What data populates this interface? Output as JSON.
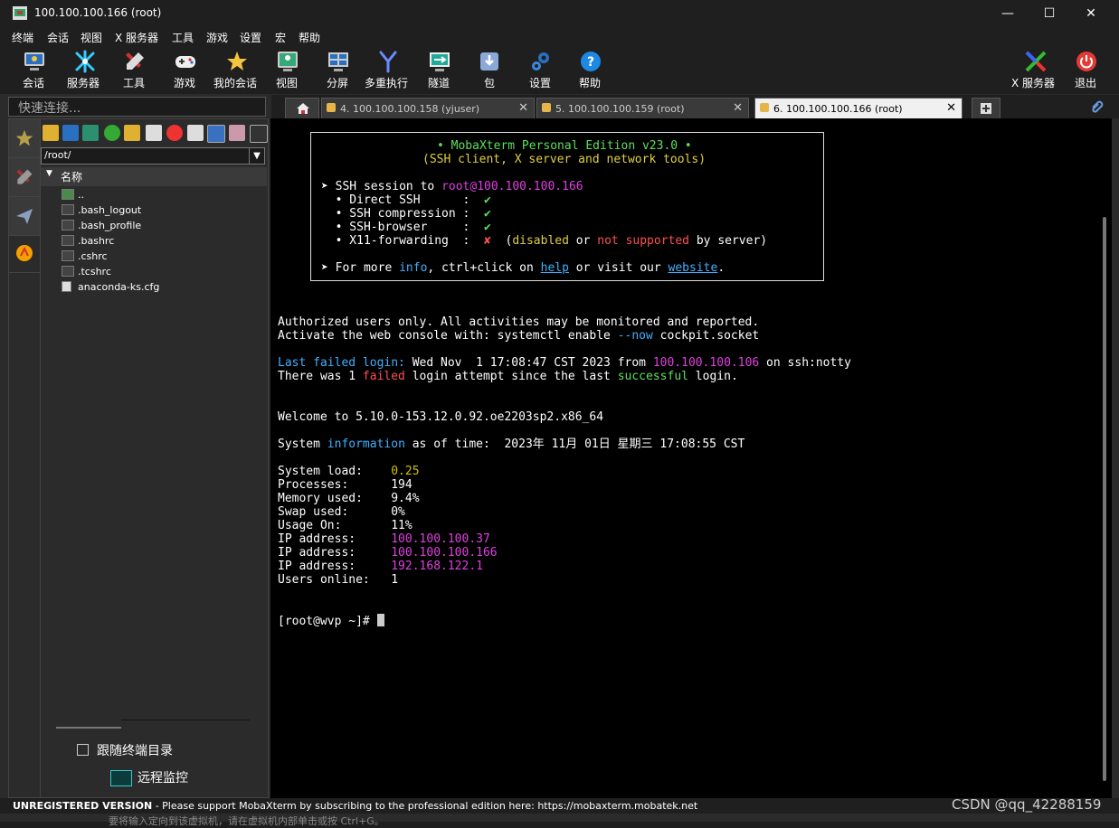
{
  "window": {
    "title": "100.100.100.166 (root)",
    "controls": [
      "—",
      "☐",
      "✕"
    ]
  },
  "menu": [
    "终端",
    "会话",
    "视图",
    "X 服务器",
    "工具",
    "游戏",
    "设置",
    "宏",
    "帮助"
  ],
  "toolbar": {
    "items": [
      {
        "label": "会话",
        "icon": "session-icon"
      },
      {
        "label": "服务器",
        "icon": "servers-icon"
      },
      {
        "label": "工具",
        "icon": "tools-icon"
      },
      {
        "label": "游戏",
        "icon": "games-icon"
      },
      {
        "label": "我的会话",
        "icon": "star-icon"
      },
      {
        "label": "视图",
        "icon": "view-icon"
      },
      {
        "label": "分屏",
        "icon": "split-icon"
      },
      {
        "label": "多重执行",
        "icon": "multiexec-icon"
      },
      {
        "label": "隧道",
        "icon": "tunnel-icon"
      },
      {
        "label": "包",
        "icon": "package-icon"
      },
      {
        "label": "设置",
        "icon": "settings-icon"
      },
      {
        "label": "帮助",
        "icon": "help-icon"
      },
      {
        "label": "X 服务器",
        "icon": "x-server-icon"
      },
      {
        "label": "退出",
        "icon": "power-icon"
      }
    ]
  },
  "quick_connect": {
    "placeholder": "快速连接..."
  },
  "tabs": [
    {
      "label": "4. 100.100.100.158 (yjuser)",
      "close": "✕"
    },
    {
      "label": "5. 100.100.100.159 (root)",
      "close": "✕"
    },
    {
      "label": "6. 100.100.100.166 (root)",
      "close": "✕"
    }
  ],
  "sftp": {
    "path": "/root/",
    "column_header": "名称",
    "files": [
      "..",
      ".bash_logout",
      ".bash_profile",
      ".bashrc",
      ".cshrc",
      ".tcshrc",
      "anaconda-ks.cfg"
    ],
    "follow_label": "跟随终端目录",
    "monitor_label": "远程监控"
  },
  "terminal": {
    "banner_title": "• MobaXterm Personal Edition v23.0 •",
    "banner_sub": "(SSH client, X server and network tools)",
    "ssh_session_prefix": "➤ SSH session to ",
    "ssh_target": "root@100.100.100.166",
    "opt1": "  • Direct SSH      :  ",
    "opt2": "  • SSH compression :  ",
    "opt3": "  • SSH-browser     :  ",
    "opt4": "  • X11-forwarding  :  ",
    "check": "✔",
    "cross": "✘",
    "x11_note_a": "  (",
    "x11_disabled": "disabled",
    "x11_or": " or ",
    "x11_notsupported": "not supported",
    "x11_by": " by server)",
    "more_a": "➤ For more ",
    "more_info": "info",
    "more_b": ", ctrl+click on ",
    "more_help": "help",
    "more_c": " or visit our ",
    "more_website": "website",
    "more_d": ".",
    "auth1": "Authorized users only. All activities may be monitored and reported.",
    "auth2a": "Activate the web console with: systemctl enable ",
    "auth2b": "--now",
    "auth2c": " cockpit.socket",
    "lastfail_a": "Last failed login:",
    "lastfail_b": " Wed Nov  1 17:08:47 CST 2023 from ",
    "lastfail_ip": "100.100.100.106",
    "lastfail_c": " on ssh:notty",
    "was_a": "There was 1 ",
    "was_failed": "failed",
    "was_b": " login attempt since the last ",
    "was_successful": "successful",
    "was_c": " login.",
    "welcome": "Welcome to 5.10.0-153.12.0.92.oe2203sp2.x86_64",
    "sysinfo_a": "System ",
    "sysinfo_info": "information",
    "sysinfo_b": " as of time:  2023年 11月 01日 星期三 17:08:55 CST",
    "load_label": "System load:    ",
    "load_val": "0.25",
    "proc": "Processes:      194",
    "mem": "Memory used:    9.4%",
    "swap": "Swap used:      0%",
    "usage": "Usage On:       11%",
    "ip_label": "IP address:     ",
    "ip1": "100.100.100.37",
    "ip2": "100.100.100.166",
    "ip3": "192.168.122.1",
    "users": "Users online:   1",
    "prompt": "[root@wvp ~]# "
  },
  "status": {
    "unregistered": "UNREGISTERED VERSION",
    "message": "  -  Please support MobaXterm by subscribing to the professional edition here:  ",
    "link": "https://mobaxterm.mobatek.net"
  },
  "watermark": "CSDN @qq_42288159",
  "bottom_text": "要将输入定向到该虚拟机，请在虚拟机内部单击或按 Ctrl+G。",
  "colors": {
    "accent_green": "#5ce05c",
    "magenta": "#e040e0",
    "cyan": "#40b0ff",
    "red": "#ff5050",
    "yellow": "#e0d040"
  }
}
